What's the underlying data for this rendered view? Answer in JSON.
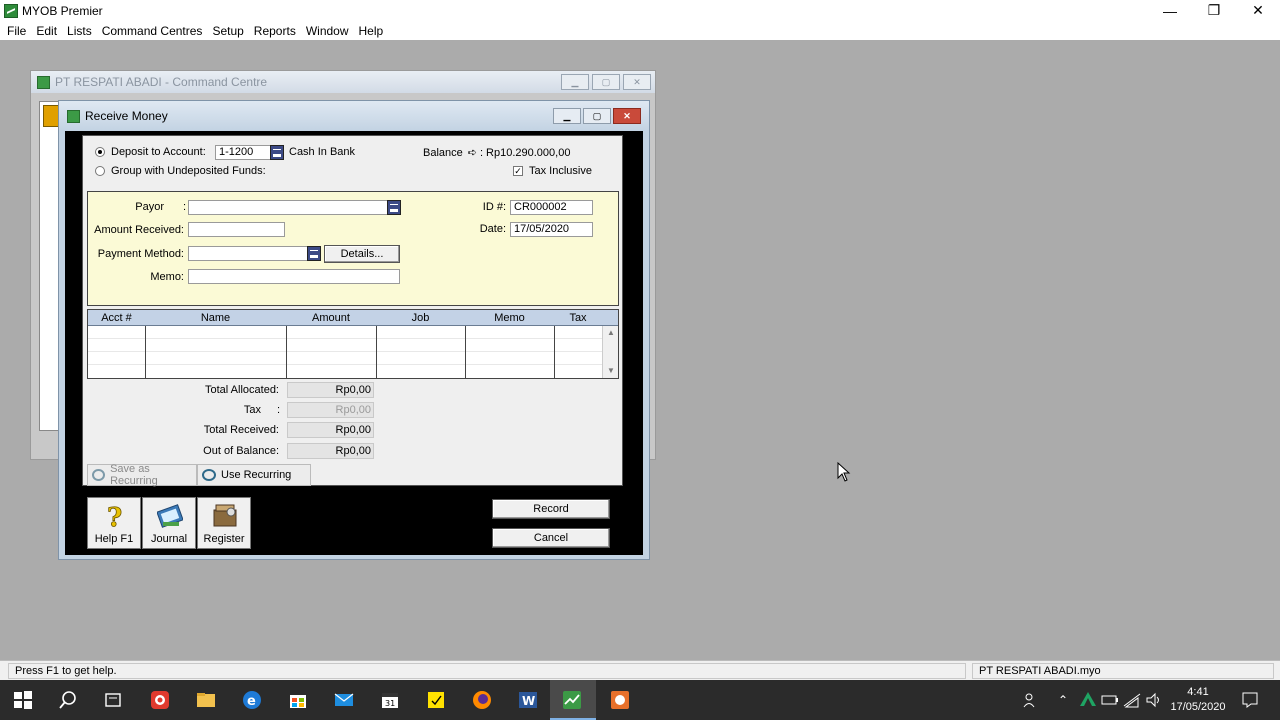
{
  "app": {
    "title": "MYOB Premier",
    "controls": {
      "minimize": "—",
      "restore": "❐",
      "close": "✕"
    }
  },
  "menu": [
    "File",
    "Edit",
    "Lists",
    "Command Centres",
    "Setup",
    "Reports",
    "Window",
    "Help"
  ],
  "command_centre": {
    "title": "PT RESPATI ABADI - Command Centre"
  },
  "dialog": {
    "title": "Receive Money",
    "deposit_label": "Deposit to Account:",
    "deposit_account": "1-1200",
    "deposit_account_name": "Cash In Bank",
    "balance_label": "Balance",
    "balance_value": "Rp10.290.000,00",
    "group_label": "Group with Undeposited Funds:",
    "tax_inclusive_label": "Tax Inclusive",
    "tax_inclusive_checked": true,
    "form": {
      "payor_label": "Payor",
      "payor_value": "",
      "amount_label": "Amount Received:",
      "amount_value": "",
      "payment_method_label": "Payment Method:",
      "payment_method_value": "",
      "details_label": "Details...",
      "memo_label": "Memo:",
      "memo_value": "",
      "id_label": "ID #:",
      "id_value": "CR000002",
      "date_label": "Date:",
      "date_value": "17/05/2020"
    },
    "grid": {
      "columns": [
        "Acct #",
        "Name",
        "Amount",
        "Job",
        "Memo",
        "Tax"
      ],
      "rows": []
    },
    "totals": {
      "allocated_label": "Total Allocated:",
      "allocated_value": "Rp0,00",
      "tax_label": "Tax",
      "tax_value": "Rp0,00",
      "received_label": "Total Received:",
      "received_value": "Rp0,00",
      "out_of_balance_label": "Out of Balance:",
      "out_of_balance_value": "Rp0,00"
    },
    "save_recurring_label": "Save as Recurring",
    "use_recurring_label": "Use Recurring",
    "tools": [
      "Help F1",
      "Journal",
      "Register"
    ],
    "record_label": "Record",
    "cancel_label": "Cancel"
  },
  "status": {
    "help_text": "Press F1 to get help.",
    "file_name": "PT RESPATI ABADI.myo"
  },
  "taskbar": {
    "time": "4:41",
    "date": "17/05/2020"
  }
}
